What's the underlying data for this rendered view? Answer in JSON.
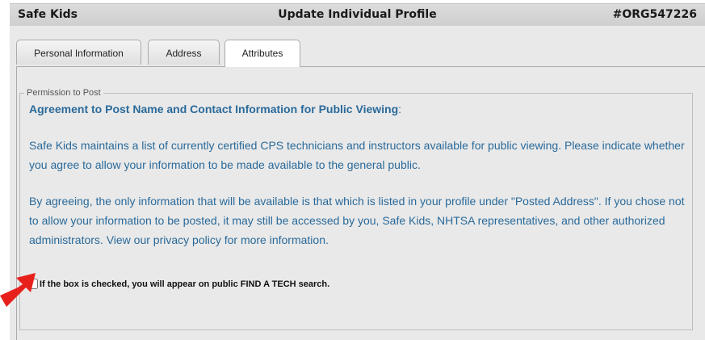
{
  "titlebar": {
    "org_name": "Safe Kids",
    "title": "Update Individual Profile",
    "org_id": "#ORG547226"
  },
  "tabs": [
    {
      "label": "Personal Information",
      "active": false
    },
    {
      "label": "Address",
      "active": false
    },
    {
      "label": "Attributes",
      "active": true
    }
  ],
  "permission": {
    "legend": "Permission to Post",
    "heading": "Agreement to Post Name and Contact Information for Public Viewing",
    "heading_suffix": ":",
    "paragraph1": "Safe Kids maintains a list of currently certified CPS technicians and instructors available for public viewing. Please indicate whether you agree to allow your information to be made available to the general public.",
    "paragraph2": "By agreeing, the only information that will be available is that which is listed in your profile under \"Posted Address\". If you chose not to allow your information to be posted, it may still be accessed by you, Safe Kids, NHTSA representatives, and other authorized administrators. View our privacy policy for more information.",
    "checkbox_label": "If the box is checked, you will appear on public FIND A TECH search.",
    "checkbox_checked": false
  },
  "colors": {
    "text_blue": "#2a6a9a",
    "arrow_red": "#e8201c",
    "panel_bg": "#e9e9e9"
  }
}
